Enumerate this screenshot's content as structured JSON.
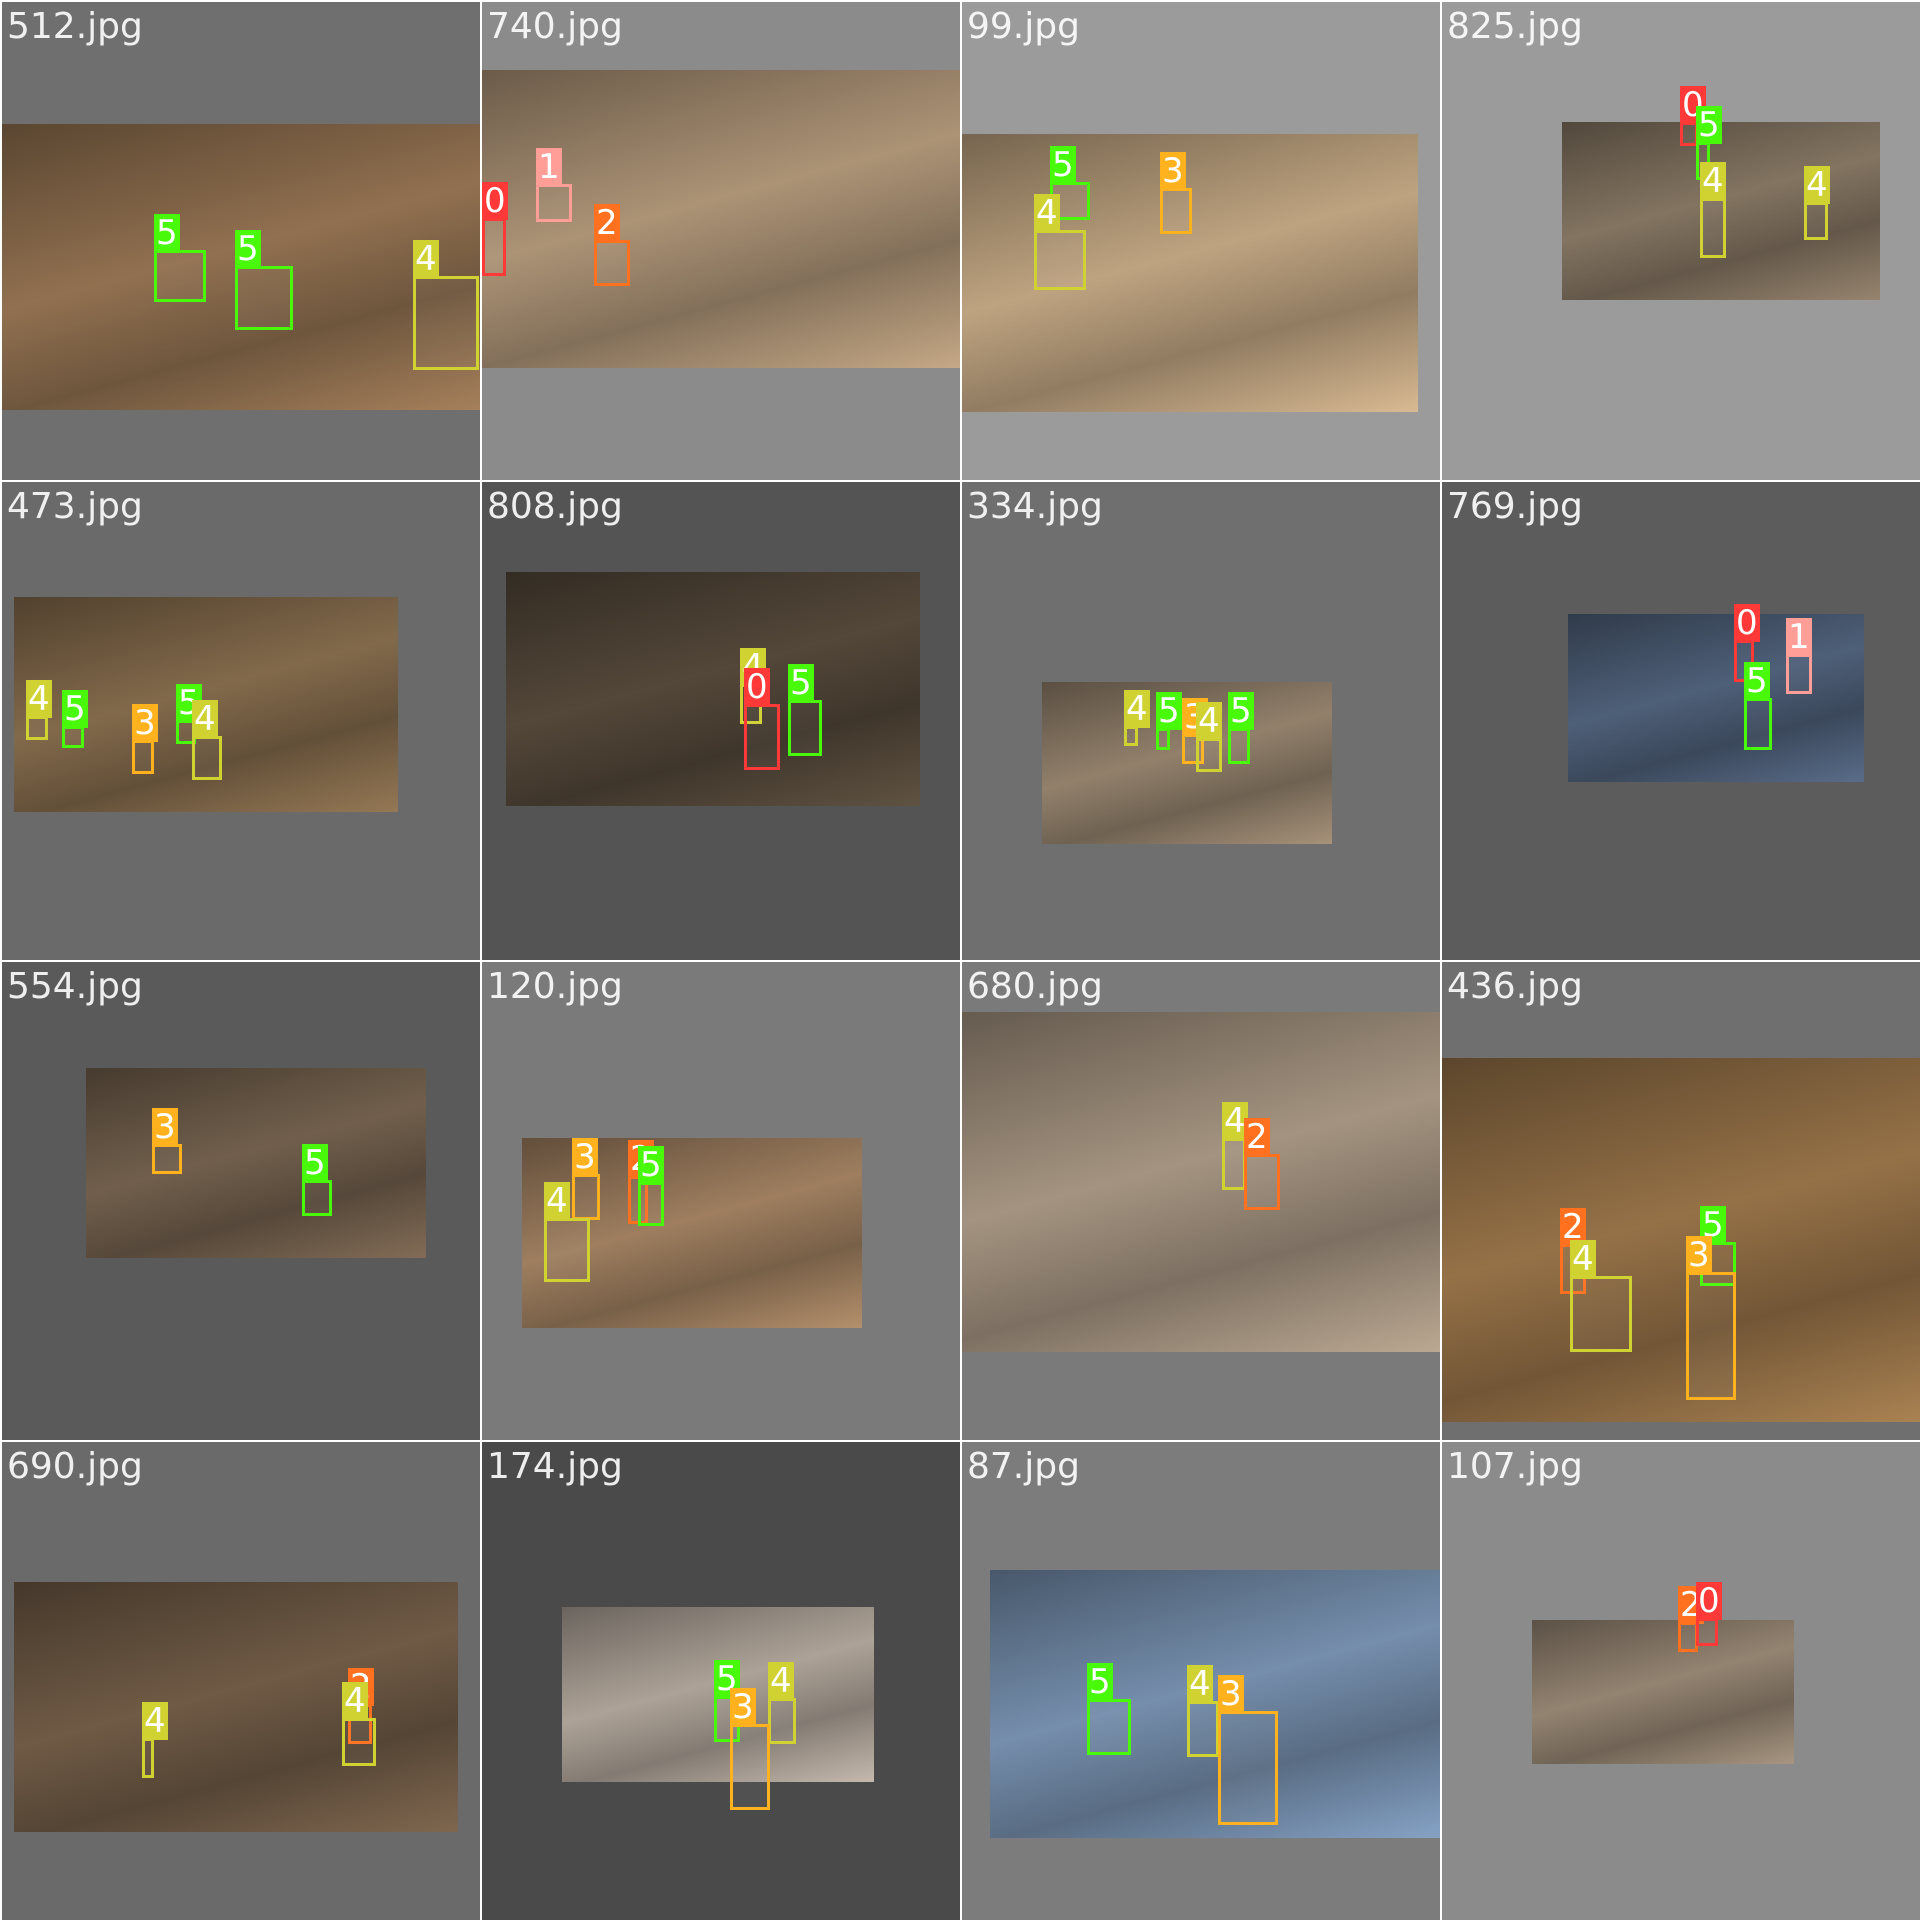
{
  "class_colors": {
    "0": "#ff3838",
    "1": "#ff9d97",
    "2": "#ff701f",
    "3": "#ffb21d",
    "4": "#cfd231",
    "5": "#48f90a"
  },
  "tiles": [
    {
      "title": "512.jpg",
      "background": "#6f6f6f",
      "scene": "#8a6b4c",
      "detections": [
        {
          "cls": "5"
        },
        {
          "cls": "5"
        },
        {
          "cls": "4"
        }
      ]
    },
    {
      "title": "740.jpg",
      "background": "#8b8b8b",
      "scene": "#a48c70",
      "detections": [
        {
          "cls": "1"
        },
        {
          "cls": "0"
        },
        {
          "cls": "2"
        }
      ]
    },
    {
      "title": "99.jpg",
      "background": "#9b9b9b",
      "scene": "#b59b7a",
      "detections": [
        {
          "cls": "5"
        },
        {
          "cls": "3"
        },
        {
          "cls": "4"
        }
      ]
    },
    {
      "title": "825.jpg",
      "background": "#9b9b9b",
      "scene": "#7d6e5c",
      "detections": [
        {
          "cls": "0"
        },
        {
          "cls": "5"
        },
        {
          "cls": "4"
        },
        {
          "cls": "4"
        }
      ]
    },
    {
      "title": "473.jpg",
      "background": "#6a6a6a",
      "scene": "#7c6447",
      "detections": [
        {
          "cls": "4"
        },
        {
          "cls": "5"
        },
        {
          "cls": "3"
        },
        {
          "cls": "5"
        },
        {
          "cls": "4"
        }
      ]
    },
    {
      "title": "808.jpg",
      "background": "#545454",
      "scene": "#4f4436",
      "detections": [
        {
          "cls": "4"
        },
        {
          "cls": "0"
        },
        {
          "cls": "5"
        }
      ]
    },
    {
      "title": "334.jpg",
      "background": "#6f6f6f",
      "scene": "#8b7a66",
      "detections": [
        {
          "cls": "4"
        },
        {
          "cls": "5"
        },
        {
          "cls": "3"
        },
        {
          "cls": "4"
        },
        {
          "cls": "5"
        }
      ]
    },
    {
      "title": "769.jpg",
      "background": "#5c5c5c",
      "scene": "#4a5a72",
      "detections": [
        {
          "cls": "0"
        },
        {
          "cls": "1"
        },
        {
          "cls": "5"
        }
      ]
    },
    {
      "title": "554.jpg",
      "background": "#5a5a5a",
      "scene": "#6c5a48",
      "detections": [
        {
          "cls": "3"
        },
        {
          "cls": "5"
        }
      ]
    },
    {
      "title": "120.jpg",
      "background": "#7a7a7a",
      "scene": "#96785a",
      "detections": [
        {
          "cls": "3"
        },
        {
          "cls": "4"
        },
        {
          "cls": "2"
        },
        {
          "cls": "5"
        }
      ]
    },
    {
      "title": "680.jpg",
      "background": "#7a7a7a",
      "scene": "#9c8c7a",
      "detections": [
        {
          "cls": "4"
        },
        {
          "cls": "2"
        }
      ]
    },
    {
      "title": "436.jpg",
      "background": "#6f6f6f",
      "scene": "#8e6c44",
      "detections": [
        {
          "cls": "2"
        },
        {
          "cls": "5"
        },
        {
          "cls": "3"
        },
        {
          "cls": "4"
        }
      ]
    },
    {
      "title": "690.jpg",
      "background": "#6a6a6a",
      "scene": "#6a5642",
      "detections": [
        {
          "cls": "4"
        },
        {
          "cls": "2"
        },
        {
          "cls": "4"
        }
      ]
    },
    {
      "title": "174.jpg",
      "background": "#4a4a4a",
      "scene": "#a49a90",
      "detections": [
        {
          "cls": "5"
        },
        {
          "cls": "4"
        },
        {
          "cls": "3"
        }
      ]
    },
    {
      "title": "87.jpg",
      "background": "#7c7c7c",
      "scene": "#6f87a4",
      "detections": [
        {
          "cls": "5"
        },
        {
          "cls": "4"
        },
        {
          "cls": "3"
        }
      ]
    },
    {
      "title": "107.jpg",
      "background": "#8b8b8b",
      "scene": "#8c7d6c",
      "detections": [
        {
          "cls": "2"
        },
        {
          "cls": "0"
        }
      ]
    }
  ]
}
